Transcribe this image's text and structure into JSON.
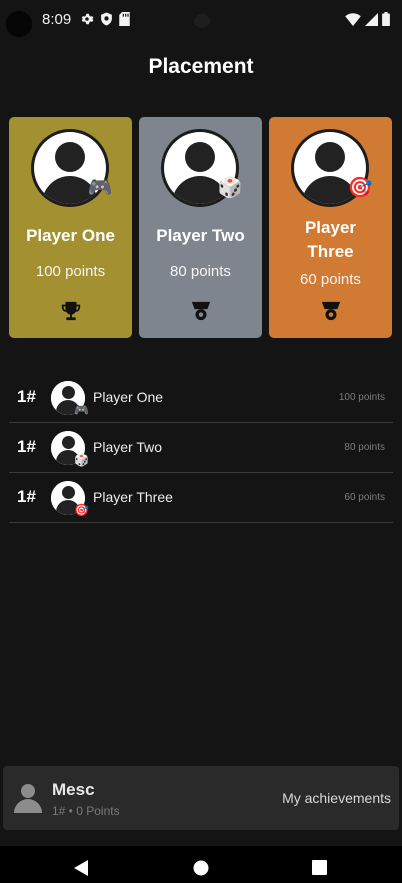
{
  "status_bar": {
    "time": "8:09",
    "icons": [
      "settings-icon",
      "shield-icon",
      "sd-card-icon",
      "wifi-icon",
      "signal-icon",
      "battery-icon"
    ]
  },
  "page": {
    "title": "Placement"
  },
  "podium": [
    {
      "name": "Player One",
      "points": "100 points",
      "badge_icon": "gamepad-icon",
      "award_icon": "trophy-icon",
      "color": "#a39031"
    },
    {
      "name": "Player Two",
      "points": "80 points",
      "badge_icon": "dice-icon",
      "award_icon": "medal-icon",
      "color": "#7f858f"
    },
    {
      "name": "Player Three",
      "points": "60 points",
      "badge_icon": "target-icon",
      "award_icon": "medal-icon",
      "color": "#d07a33"
    }
  ],
  "ranking": [
    {
      "rank": "1#",
      "name": "Player One",
      "points": "100 points",
      "badge_icon": "gamepad-icon"
    },
    {
      "rank": "1#",
      "name": "Player Two",
      "points": "80 points",
      "badge_icon": "dice-icon"
    },
    {
      "rank": "1#",
      "name": "Player Three",
      "points": "60 points",
      "badge_icon": "target-icon"
    }
  ],
  "user_bar": {
    "name": "Mesc",
    "subtitle": "1# • 0 Points",
    "achievements_label": "My achievements"
  },
  "nav": {
    "icons": [
      "back-icon",
      "home-icon",
      "recents-icon"
    ]
  },
  "colors": {
    "background": "#141414",
    "gold": "#a39031",
    "silver": "#7f858f",
    "bronze": "#d07a33"
  }
}
